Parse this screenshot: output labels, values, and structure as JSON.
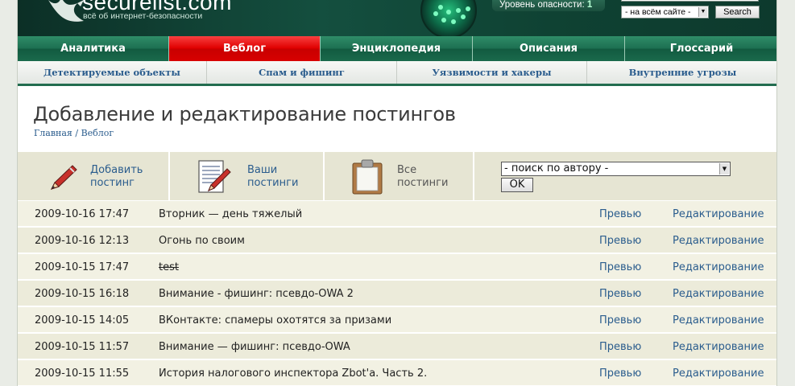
{
  "header": {
    "logo_text": "securelist.com",
    "logo_subtitle": "всё об интернет-безопасности",
    "threat_label": "Уровень опасности:",
    "threat_level": "1",
    "search_scope": "- на всём сайте -",
    "search_button": "Search"
  },
  "main_nav": [
    {
      "label": "Аналитика",
      "active": false
    },
    {
      "label": "Веблог",
      "active": true
    },
    {
      "label": "Энциклопедия",
      "active": false
    },
    {
      "label": "Описания",
      "active": false
    },
    {
      "label": "Глоссарий",
      "active": false
    }
  ],
  "sub_nav": [
    {
      "label": "Детектируемые объекты"
    },
    {
      "label": "Спам и фишинг"
    },
    {
      "label": "Уязвимости и хакеры"
    },
    {
      "label": "Внутренние угрозы"
    }
  ],
  "page": {
    "title": "Добавление и редактирование постингов",
    "breadcrumb": {
      "home": "Главная",
      "separator": " / ",
      "current": "Веблог"
    }
  },
  "toolbar": {
    "add_line1": "Добавить",
    "add_line2": "постинг",
    "yours_line1": "Ваши",
    "yours_line2": "постинги",
    "all_line1": "Все",
    "all_line2": "постинги",
    "author_select": "- поиск по автору -",
    "ok_button": "OK"
  },
  "postings": [
    {
      "date": "2009-10-16 17:47",
      "title": "Вторник — день тяжелый",
      "struck": false,
      "preview": "Превью",
      "edit": "Редактирование"
    },
    {
      "date": "2009-10-16 12:13",
      "title": "Огонь по своим",
      "struck": false,
      "preview": "Превью",
      "edit": "Редактирование"
    },
    {
      "date": "2009-10-15 17:47",
      "title": "test",
      "struck": true,
      "preview": "Превью",
      "edit": "Редактирование"
    },
    {
      "date": "2009-10-15 16:18",
      "title": "Внимание - фишинг: псевдо-OWA 2",
      "struck": false,
      "preview": "Превью",
      "edit": "Редактирование"
    },
    {
      "date": "2009-10-15 14:05",
      "title": "ВКонтакте: спамеры охотятся за призами",
      "struck": false,
      "preview": "Превью",
      "edit": "Редактирование"
    },
    {
      "date": "2009-10-15 11:57",
      "title": "Внимание — фишинг: псевдо-OWA",
      "struck": false,
      "preview": "Превью",
      "edit": "Редактирование"
    },
    {
      "date": "2009-10-15 11:55",
      "title": "История налогового инспектора Zbot'a. Часть 2.",
      "struck": false,
      "preview": "Превью",
      "edit": "Редактирование"
    }
  ],
  "colors": {
    "nav_green": "#1d7052",
    "nav_active_red": "#e00000",
    "link_blue": "#2a5c8d",
    "toolbar_bg": "#e6e5d3",
    "row_bg": "#f2f1e3"
  },
  "icons": {
    "add": "pencil-icon",
    "yours": "document-pencil-icon",
    "all": "clipboard-icon"
  }
}
